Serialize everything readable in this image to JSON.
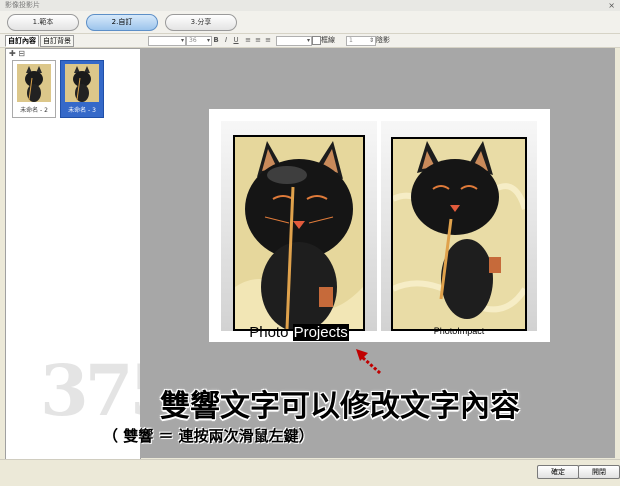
{
  "window": {
    "title": "影像投影片",
    "close": "×"
  },
  "steps": [
    {
      "label": "1.範本"
    },
    {
      "label": "2.自訂"
    },
    {
      "label": "3.分享"
    }
  ],
  "toolbar": {
    "tabs": [
      {
        "label": "自訂內容"
      },
      {
        "label": "自訂背景"
      }
    ],
    "font_size": "36",
    "bold": "B",
    "italic": "I",
    "underline": "U",
    "border_label": "框線",
    "shadow_label": "陰影",
    "shadow_value": "1"
  },
  "panel": {
    "icon_add": "✚",
    "icon_remove": "⊟",
    "thumbs": [
      {
        "caption": "未命名 - 2"
      },
      {
        "caption": "未命名 - 3"
      }
    ]
  },
  "canvas": {
    "caption_left_a": "Photo",
    "caption_left_b": "Projects",
    "caption_right": "PhotoImpact"
  },
  "annotations": {
    "main": "雙響文字可以修改文字內容",
    "sub": "（ 雙響 ＝ 連按兩次滑鼠左鍵）",
    "watermark": "375"
  },
  "footer": {
    "ok": "確定",
    "open": "開閉"
  }
}
